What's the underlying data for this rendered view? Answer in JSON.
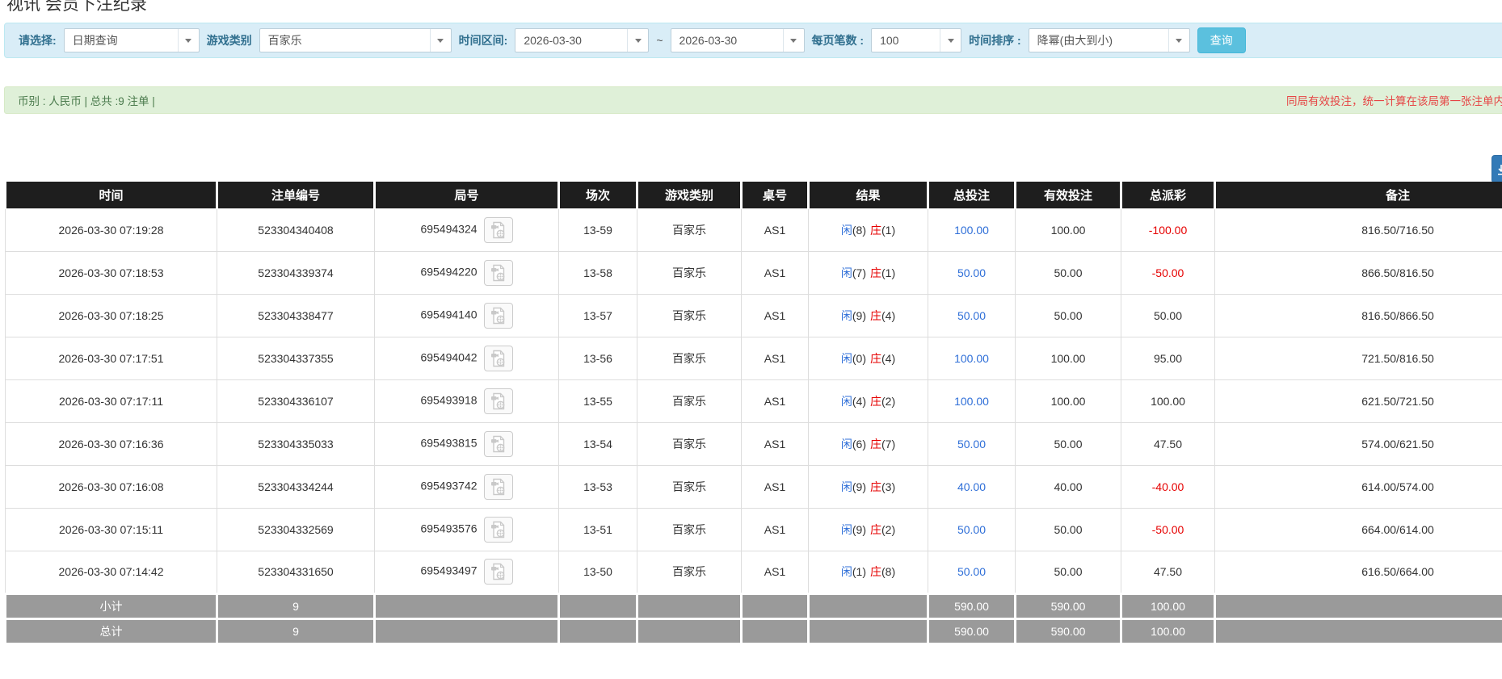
{
  "page": {
    "title": "视讯 会员下注纪录"
  },
  "filters": {
    "select_label": "请选择:",
    "select_value": "日期查询",
    "game_type_label": "游戏类别",
    "game_type_value": "百家乐",
    "time_range_label": "时间区间:",
    "date_from": "2026-03-30",
    "range_separator": "~",
    "date_to": "2026-03-30",
    "page_size_label": "每页笔数 :",
    "page_size_value": "100",
    "sort_label": "时间排序 :",
    "sort_value": "降幂(由大到小)",
    "search_button": "查询"
  },
  "summary": {
    "left_text": "币别 : 人民币 | 总共 :9 注单 |",
    "right_notice": "同局有效投注，统一计算在该局第一张注单内"
  },
  "table": {
    "columns": [
      "时间",
      "注单编号",
      "局号",
      "场次",
      "游戏类别",
      "桌号",
      "结果",
      "总投注",
      "有效投注",
      "总派彩",
      "备注"
    ],
    "rows": [
      {
        "time": "2026-03-30 07:19:28",
        "bet_id": "523304340408",
        "round_id": "695494324",
        "session": "13-59",
        "game": "百家乐",
        "table_no": "AS1",
        "result_player": "闲",
        "result_player_score": "(8)",
        "result_banker": "庄",
        "result_banker_score": "(1)",
        "total_bet": "100.00",
        "valid_bet": "100.00",
        "payout": "-100.00",
        "remark": "816.50/716.50"
      },
      {
        "time": "2026-03-30 07:18:53",
        "bet_id": "523304339374",
        "round_id": "695494220",
        "session": "13-58",
        "game": "百家乐",
        "table_no": "AS1",
        "result_player": "闲",
        "result_player_score": "(7)",
        "result_banker": "庄",
        "result_banker_score": "(1)",
        "total_bet": "50.00",
        "valid_bet": "50.00",
        "payout": "-50.00",
        "remark": "866.50/816.50"
      },
      {
        "time": "2026-03-30 07:18:25",
        "bet_id": "523304338477",
        "round_id": "695494140",
        "session": "13-57",
        "game": "百家乐",
        "table_no": "AS1",
        "result_player": "闲",
        "result_player_score": "(9)",
        "result_banker": "庄",
        "result_banker_score": "(4)",
        "total_bet": "50.00",
        "valid_bet": "50.00",
        "payout": "50.00",
        "remark": "816.50/866.50"
      },
      {
        "time": "2026-03-30 07:17:51",
        "bet_id": "523304337355",
        "round_id": "695494042",
        "session": "13-56",
        "game": "百家乐",
        "table_no": "AS1",
        "result_player": "闲",
        "result_player_score": "(0)",
        "result_banker": "庄",
        "result_banker_score": "(4)",
        "total_bet": "100.00",
        "valid_bet": "100.00",
        "payout": "95.00",
        "remark": "721.50/816.50"
      },
      {
        "time": "2026-03-30 07:17:11",
        "bet_id": "523304336107",
        "round_id": "695493918",
        "session": "13-55",
        "game": "百家乐",
        "table_no": "AS1",
        "result_player": "闲",
        "result_player_score": "(4)",
        "result_banker": "庄",
        "result_banker_score": "(2)",
        "total_bet": "100.00",
        "valid_bet": "100.00",
        "payout": "100.00",
        "remark": "621.50/721.50"
      },
      {
        "time": "2026-03-30 07:16:36",
        "bet_id": "523304335033",
        "round_id": "695493815",
        "session": "13-54",
        "game": "百家乐",
        "table_no": "AS1",
        "result_player": "闲",
        "result_player_score": "(6)",
        "result_banker": "庄",
        "result_banker_score": "(7)",
        "total_bet": "50.00",
        "valid_bet": "50.00",
        "payout": "47.50",
        "remark": "574.00/621.50"
      },
      {
        "time": "2026-03-30 07:16:08",
        "bet_id": "523304334244",
        "round_id": "695493742",
        "session": "13-53",
        "game": "百家乐",
        "table_no": "AS1",
        "result_player": "闲",
        "result_player_score": "(9)",
        "result_banker": "庄",
        "result_banker_score": "(3)",
        "total_bet": "40.00",
        "valid_bet": "40.00",
        "payout": "-40.00",
        "remark": "614.00/574.00"
      },
      {
        "time": "2026-03-30 07:15:11",
        "bet_id": "523304332569",
        "round_id": "695493576",
        "session": "13-51",
        "game": "百家乐",
        "table_no": "AS1",
        "result_player": "闲",
        "result_player_score": "(9)",
        "result_banker": "庄",
        "result_banker_score": "(2)",
        "total_bet": "50.00",
        "valid_bet": "50.00",
        "payout": "-50.00",
        "remark": "664.00/614.00"
      },
      {
        "time": "2026-03-30 07:14:42",
        "bet_id": "523304331650",
        "round_id": "695493497",
        "session": "13-50",
        "game": "百家乐",
        "table_no": "AS1",
        "result_player": "闲",
        "result_player_score": "(1)",
        "result_banker": "庄",
        "result_banker_score": "(8)",
        "total_bet": "50.00",
        "valid_bet": "50.00",
        "payout": "47.50",
        "remark": "616.50/664.00"
      }
    ],
    "footer": [
      {
        "label": "小计",
        "count": "9",
        "total_bet": "590.00",
        "valid_bet": "590.00",
        "payout": "100.00"
      },
      {
        "label": "总计",
        "count": "9",
        "total_bet": "590.00",
        "valid_bet": "590.00",
        "payout": "100.00"
      }
    ]
  },
  "colors": {
    "accent_blue": "#2f6fd8",
    "negative_red": "#e60000",
    "notice_red": "#e64545",
    "panel_blue_bg": "#d9edf7",
    "summary_green_bg": "#dff0d8",
    "header_black": "#1e1e1e",
    "footer_gray": "#9a9a9a",
    "search_button_bg": "#5bc0de",
    "export_button_bg": "#337ab7"
  }
}
